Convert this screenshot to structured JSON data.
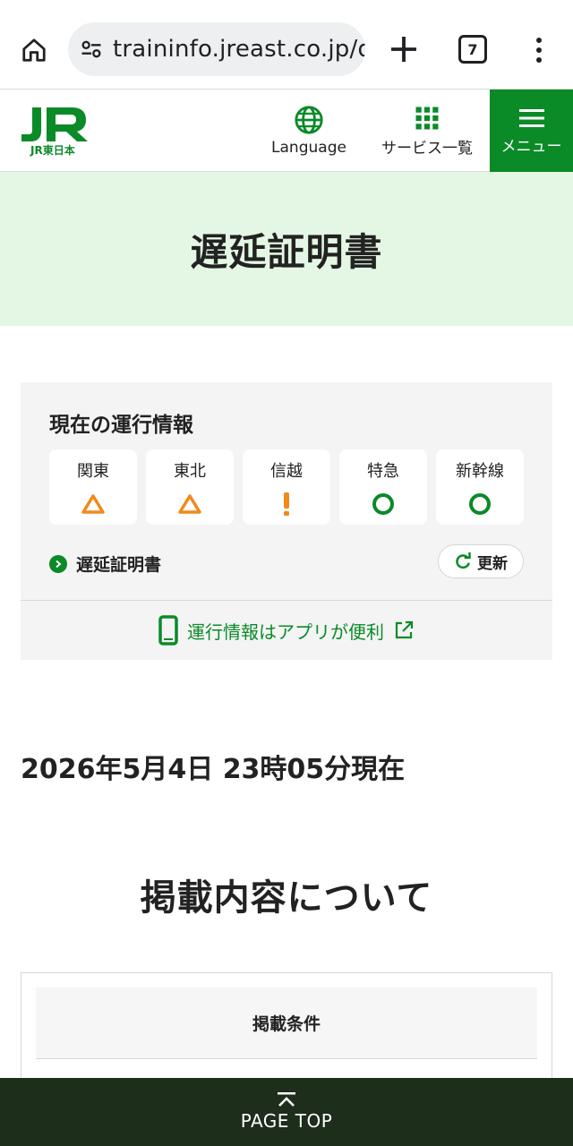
{
  "browser": {
    "url": "traininfo.jreast.co.jp/d",
    "tab_count": "7"
  },
  "header": {
    "logo_sub": "JR東日本",
    "language_label": "Language",
    "services_label": "サービス一覧",
    "menu_label": "メニュー",
    "brand_color": "#0b8a28"
  },
  "page": {
    "title": "遅延証明書"
  },
  "status": {
    "heading": "現在の運行情報",
    "regions": [
      {
        "name": "関東",
        "status_icon": "triangle-icon"
      },
      {
        "name": "東北",
        "status_icon": "triangle-icon"
      },
      {
        "name": "信越",
        "status_icon": "exclamation-icon"
      },
      {
        "name": "特急",
        "status_icon": "circle-icon"
      },
      {
        "name": "新幹線",
        "status_icon": "circle-icon"
      }
    ],
    "cert_link": "遅延証明書",
    "refresh_label": "更新",
    "app_link": "運行情報はアプリが便利"
  },
  "timestamp": "2026年5月4日 23時05分現在",
  "section": {
    "heading": "掲載内容について",
    "table_header": "掲載条件"
  },
  "page_top": "PAGE TOP"
}
